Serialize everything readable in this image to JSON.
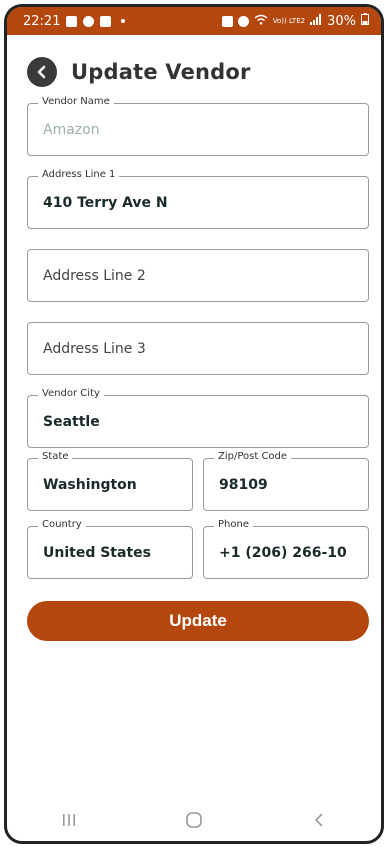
{
  "status_bar": {
    "time": "22:21",
    "network": "Vo)) LTE2",
    "battery": "30%"
  },
  "header": {
    "title": "Update Vendor"
  },
  "form": {
    "vendor_name": {
      "label": "Vendor Name",
      "value": "Amazon"
    },
    "address1": {
      "label": "Address Line 1",
      "value": "410 Terry Ave N"
    },
    "address2": {
      "placeholder": "Address Line 2"
    },
    "address3": {
      "placeholder": "Address Line 3"
    },
    "city": {
      "label": "Vendor City",
      "value": "Seattle"
    },
    "state": {
      "label": "State",
      "value": "Washington"
    },
    "zip": {
      "label": "Zip/Post Code",
      "value": "98109"
    },
    "country": {
      "label": "Country",
      "value": "United States"
    },
    "phone": {
      "label": "Phone",
      "value": "+1 (206) 266-10"
    }
  },
  "actions": {
    "update_label": "Update"
  },
  "colors": {
    "accent": "#b3470d",
    "placeholder_text": "#9bb0a9"
  }
}
